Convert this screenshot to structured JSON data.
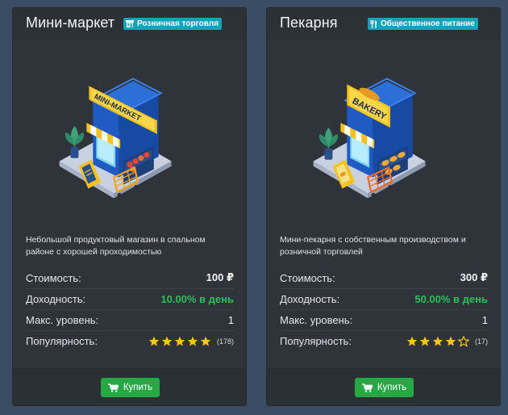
{
  "cards": [
    {
      "title": "Мини-маркет",
      "badge": {
        "icon": "store-icon",
        "label": "Розничная торговля"
      },
      "illustration": {
        "sign_text": "MINI-MARKET"
      },
      "description": "Небольшой продуктовый магазин в спальном районе с хорошей проходимостью",
      "stats": {
        "cost_label": "Стоимость:",
        "cost_value": "100 ₽",
        "income_label": "Доходность:",
        "income_value": "10.00% в день",
        "level_label": "Макс. уровень:",
        "level_value": "1",
        "popularity_label": "Популярность:",
        "rating": 5,
        "rating_count": "(178)"
      },
      "buy_label": "Купить"
    },
    {
      "title": "Пекарня",
      "badge": {
        "icon": "utensils-icon",
        "label": "Общественное питание"
      },
      "illustration": {
        "sign_text": "BAKERY"
      },
      "description": "Мини-пекарня с собственным производством и розничной торговлей",
      "stats": {
        "cost_label": "Стоимость:",
        "cost_value": "300 ₽",
        "income_label": "Доходность:",
        "income_value": "50.00% в день",
        "level_label": "Макс. уровень:",
        "level_value": "1",
        "popularity_label": "Популярность:",
        "rating": 4,
        "rating_count": "(17)"
      },
      "buy_label": "Купить"
    }
  ],
  "colors": {
    "background": "#3a4d64",
    "card": "#2f343a",
    "badge": "#17a2b8",
    "income": "#2fbf5a",
    "buy_button": "#28a745",
    "star": "#f5c518"
  }
}
